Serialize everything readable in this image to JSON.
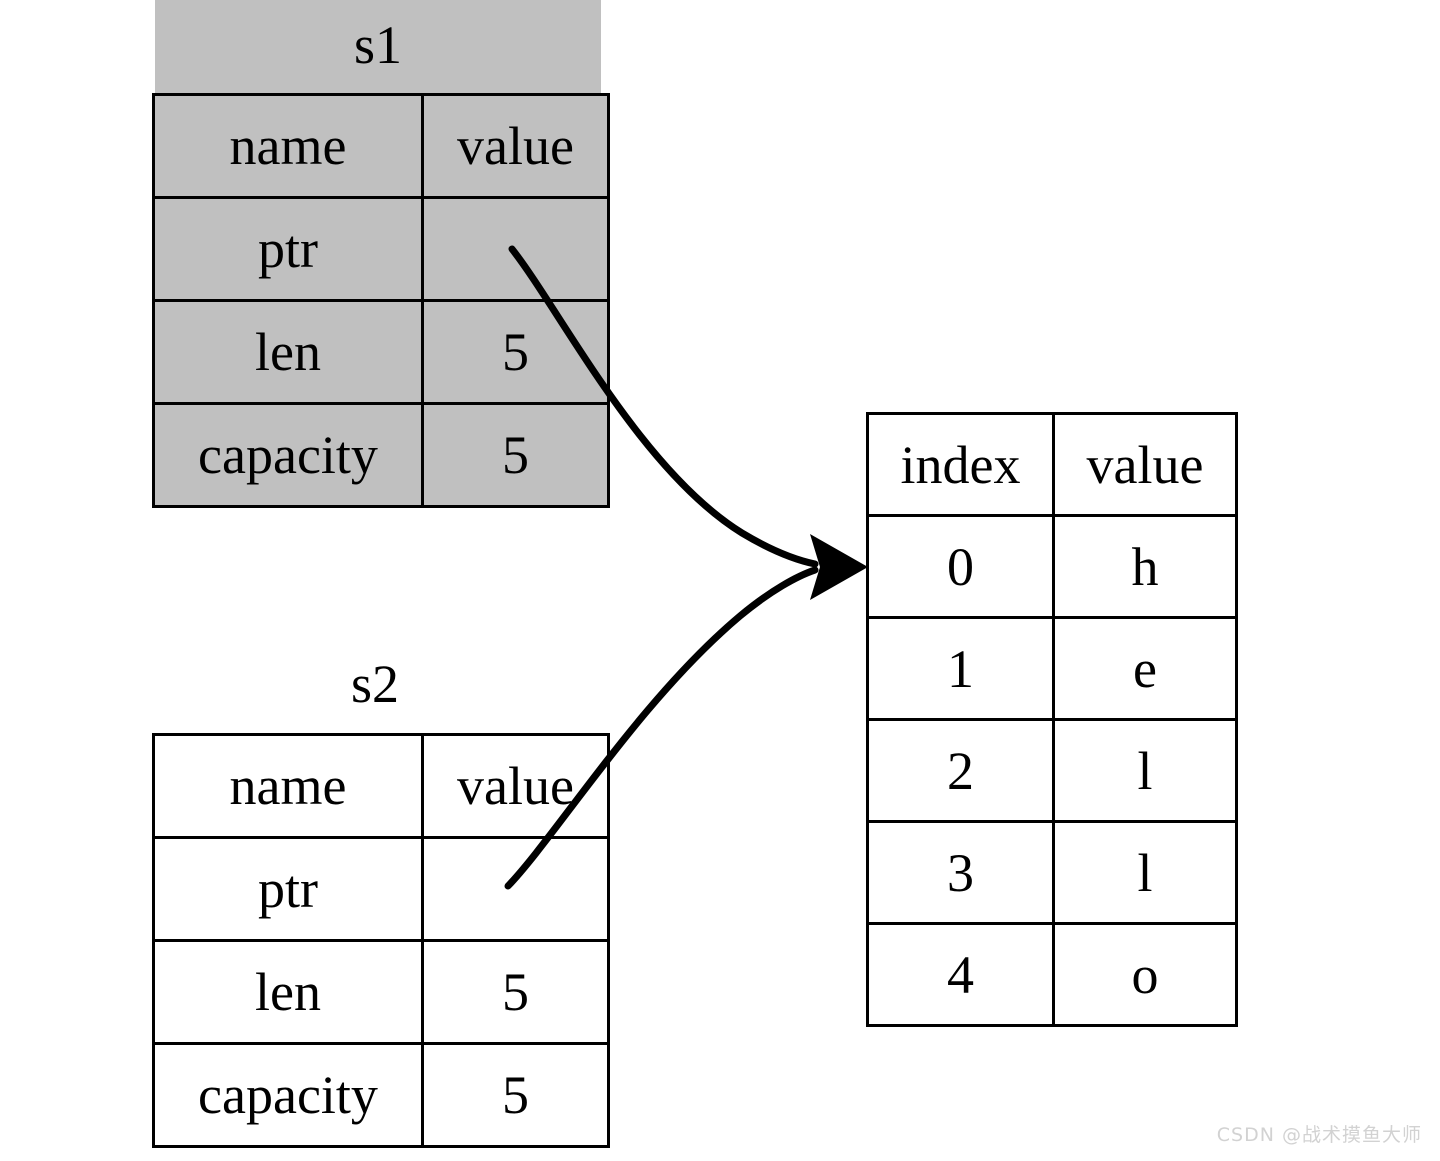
{
  "diagram": {
    "title_s1": "s1",
    "title_s2": "s2",
    "gray_fill": "#c0c0c0",
    "stroke": "#000000",
    "background": "#ffffff"
  },
  "s1_table": {
    "caption": "s1",
    "columns": [
      "name",
      "value"
    ],
    "rows": [
      {
        "name": "ptr",
        "value": ""
      },
      {
        "name": "len",
        "value": "5"
      },
      {
        "name": "capacity",
        "value": "5"
      }
    ]
  },
  "s2_table": {
    "caption": "s2",
    "columns": [
      "name",
      "value"
    ],
    "rows": [
      {
        "name": "ptr",
        "value": ""
      },
      {
        "name": "len",
        "value": "5"
      },
      {
        "name": "capacity",
        "value": "5"
      }
    ]
  },
  "heap_table": {
    "columns": [
      "index",
      "value"
    ],
    "rows": [
      {
        "index": "0",
        "value": "h"
      },
      {
        "index": "1",
        "value": "e"
      },
      {
        "index": "2",
        "value": "l"
      },
      {
        "index": "3",
        "value": "l"
      },
      {
        "index": "4",
        "value": "o"
      }
    ]
  },
  "arrows": [
    {
      "name": "s1-ptr-to-heap",
      "from": "s1.ptr",
      "to": "heap.index0"
    },
    {
      "name": "s2-ptr-to-heap",
      "from": "s2.ptr",
      "to": "heap.index0"
    }
  ],
  "watermark": {
    "text": "CSDN @战术摸鱼大师"
  }
}
